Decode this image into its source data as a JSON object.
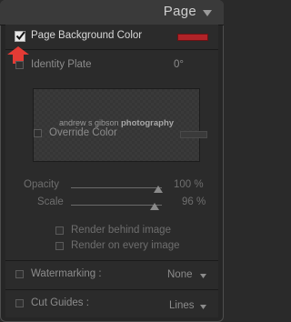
{
  "panel": {
    "title": "Page",
    "colors": {
      "background_swatch": "#b02328",
      "override_swatch": "#3a3a3a",
      "annotation_arrow": "#e33b35"
    }
  },
  "page_background": {
    "label": "Page Background Color",
    "checked": true
  },
  "identity_plate": {
    "label": "Identity Plate",
    "checked": false,
    "rotation": "0°",
    "plate_text_regular": "andrew s gibson",
    "plate_text_bold": "photography",
    "override_label": "Override Color",
    "override_checked": false
  },
  "opacity": {
    "label": "Opacity",
    "value_text": "100 %",
    "value": 100
  },
  "scale": {
    "label": "Scale",
    "value_text": "96 %",
    "value": 96
  },
  "render_behind": {
    "label": "Render behind image",
    "checked": false
  },
  "render_every": {
    "label": "Render on every image",
    "checked": false
  },
  "watermarking": {
    "label": "Watermarking :",
    "checked": false,
    "value": "None"
  },
  "cut_guides": {
    "label": "Cut Guides :",
    "checked": false,
    "value": "Lines"
  }
}
